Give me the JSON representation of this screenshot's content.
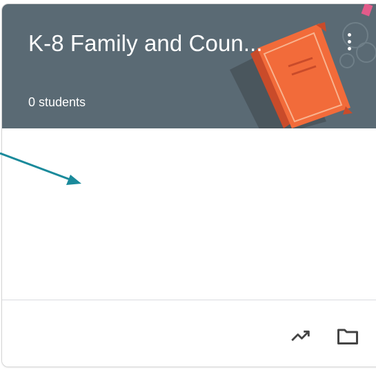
{
  "class_card": {
    "title": "K-8 Family and Coun...",
    "student_count": "0 students",
    "menu_icon": "more-vertical-icon",
    "footer_icons": [
      "trending-up-icon",
      "folder-icon"
    ],
    "header_color": "#5a6a74",
    "book_color": "#f26b3a"
  }
}
